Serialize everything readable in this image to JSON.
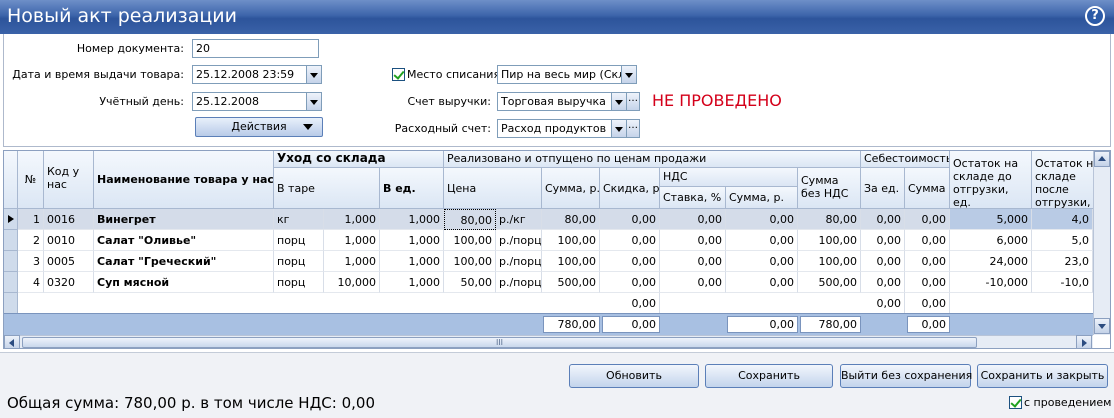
{
  "window": {
    "title": "Новый акт реализации",
    "help_icon": "?"
  },
  "form": {
    "doc_number_label": "Номер документа:",
    "doc_number": "20",
    "issue_datetime_label": "Дата и время выдачи товара:",
    "issue_datetime": "25.12.2008 23:59",
    "account_day_label": "Учётный день:",
    "account_day": "25.12.2008",
    "actions_label": "Действия",
    "writeoff_place_label": "Место списания",
    "writeoff_place_checked": true,
    "writeoff_place": "Пир на весь мир (Склад",
    "revenue_account_label": "Счет выручки:",
    "revenue_account": "Торговая выручка",
    "expense_account_label": "Расходный счет:",
    "expense_account": "Расход продуктов",
    "status": "НЕ ПРОВЕДЕНО",
    "status_color": "#d4001a"
  },
  "table": {
    "headers": {
      "num": "№",
      "code": "Код у нас",
      "name": "Наименование товара у нас",
      "warehouse_group": "Уход со склада",
      "in_pack": "В таре",
      "in_units": "В ед.",
      "sold_group": "Реализовано и отпущено по ценам продажи",
      "price": "Цена",
      "sum": "Сумма, р.",
      "discount": "Скидка, р.",
      "vat_group": "НДС",
      "vat_rate": "Ставка, %",
      "vat_sum": "Сумма, р.",
      "sum_no_vat": "Сумма без НДС",
      "cost_group": "Себестоимость",
      "cost_unit": "За ед.",
      "cost_sum": "Сумма",
      "stock_before": "Остаток на складе до отгрузки, ед.",
      "stock_after": "Остаток на складе после отгрузки, ед."
    },
    "rows": [
      {
        "num": "1",
        "code": "0016",
        "name": "Винегрет",
        "pack": "кг",
        "pack_qty": "1,000",
        "units": "1,000",
        "price": "80,00",
        "price_unit": "р./кг",
        "sum": "80,00",
        "discount": "0,00",
        "vat_rate": "0,00",
        "vat_sum": "0,00",
        "sum_no_vat": "80,00",
        "cost_unit": "0,00",
        "cost_sum": "0,00",
        "stock_before": "5,000",
        "stock_after": "4,0"
      },
      {
        "num": "2",
        "code": "0010",
        "name": "Салат \"Оливье\"",
        "pack": "порц",
        "pack_qty": "1,000",
        "units": "1,000",
        "price": "100,00",
        "price_unit": "р./порц",
        "sum": "100,00",
        "discount": "0,00",
        "vat_rate": "0,00",
        "vat_sum": "0,00",
        "sum_no_vat": "100,00",
        "cost_unit": "0,00",
        "cost_sum": "0,00",
        "stock_before": "6,000",
        "stock_after": "5,0"
      },
      {
        "num": "3",
        "code": "0005",
        "name": "Салат \"Греческий\"",
        "pack": "порц",
        "pack_qty": "1,000",
        "units": "1,000",
        "price": "100,00",
        "price_unit": "р./порц",
        "sum": "100,00",
        "discount": "0,00",
        "vat_rate": "0,00",
        "vat_sum": "0,00",
        "sum_no_vat": "100,00",
        "cost_unit": "0,00",
        "cost_sum": "0,00",
        "stock_before": "24,000",
        "stock_after": "23,0"
      },
      {
        "num": "4",
        "code": "0320",
        "name": "Суп мясной",
        "pack": "порц",
        "pack_qty": "10,000",
        "units": "1,000",
        "price": "50,00",
        "price_unit": "р./порц",
        "sum": "500,00",
        "discount": "0,00",
        "vat_rate": "0,00",
        "vat_sum": "0,00",
        "sum_no_vat": "500,00",
        "cost_unit": "0,00",
        "cost_sum": "0,00",
        "stock_before": "-10,000",
        "stock_after": "-10,0"
      }
    ],
    "empty_row": {
      "discount": "0,00",
      "cost_unit": "0,00",
      "cost_sum": "0,00"
    },
    "totals": {
      "sum": "780,00",
      "discount": "0,00",
      "vat_sum": "0,00",
      "sum_no_vat": "780,00",
      "cost_sum": "0,00"
    },
    "hscroll_grip": "III"
  },
  "footer": {
    "refresh": "Обновить",
    "save": "Сохранить",
    "exit_no_save": "Выйти без сохранения",
    "save_close": "Сохранить и закрыть",
    "total_text": "Общая сумма: 780,00 р. в том числе НДС: 0,00",
    "post_label": "с проведением",
    "post_checked": true
  }
}
